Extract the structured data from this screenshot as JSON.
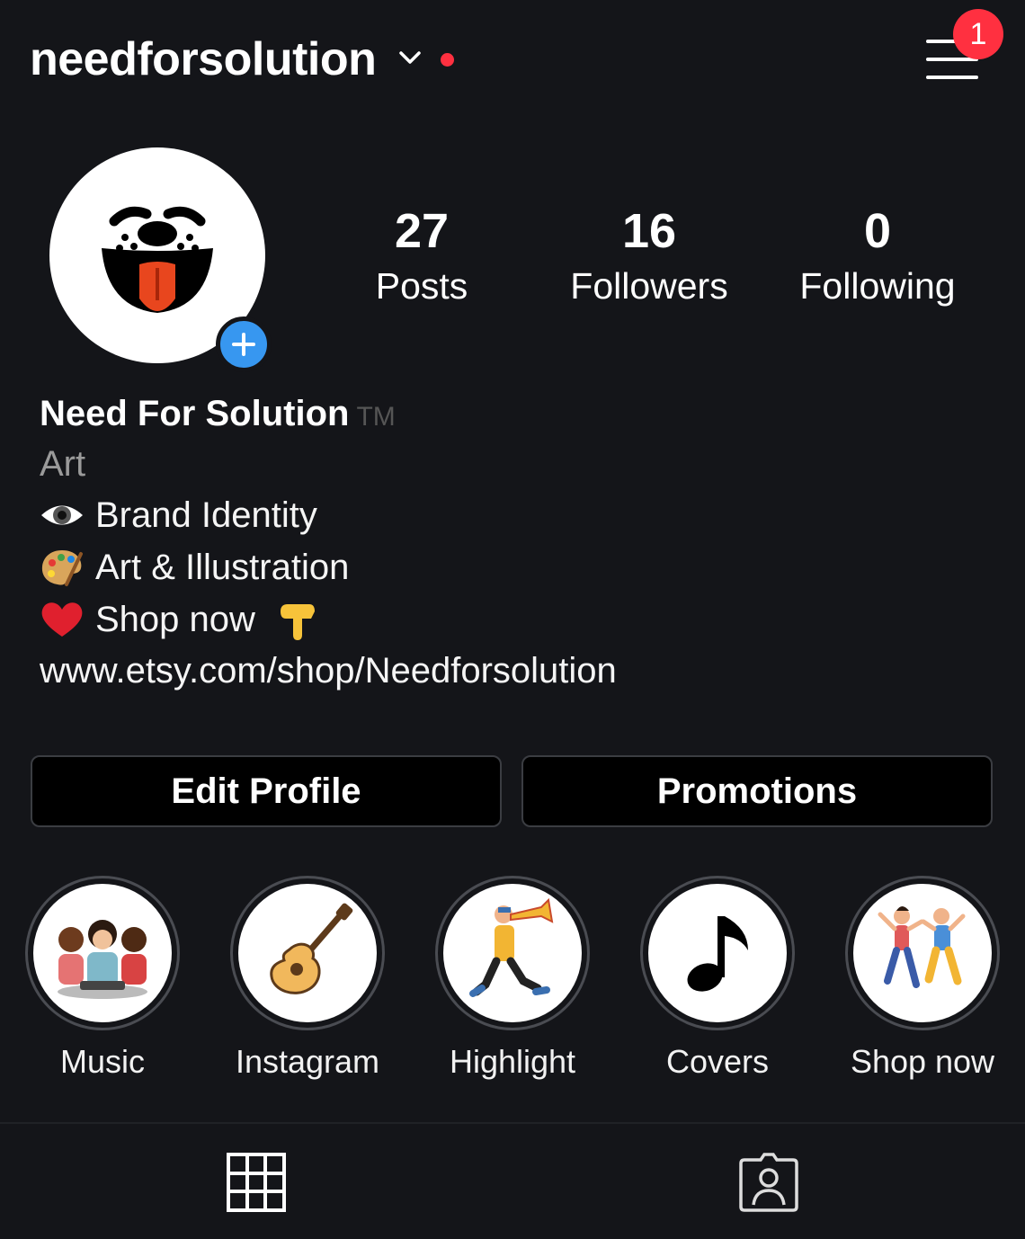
{
  "header": {
    "username": "needforsolution",
    "notification_count": "1"
  },
  "stats": [
    {
      "value": "27",
      "label": "Posts"
    },
    {
      "value": "16",
      "label": "Followers"
    },
    {
      "value": "0",
      "label": "Following"
    }
  ],
  "bio": {
    "name": "Need For Solution",
    "name_mark": "TM",
    "category": "Art",
    "lines": [
      {
        "icon": "eye-icon",
        "text": "Brand Identity"
      },
      {
        "icon": "palette-icon",
        "text": "Art & Illustration"
      },
      {
        "icon": "heart-icon",
        "text": "Shop now"
      }
    ],
    "link": "www.etsy.com/shop/Needforsolution"
  },
  "buttons": {
    "edit_profile": "Edit Profile",
    "promotions": "Promotions"
  },
  "highlights": [
    {
      "label": "Music"
    },
    {
      "label": "Instagram"
    },
    {
      "label": "Highlight"
    },
    {
      "label": "Covers"
    },
    {
      "label": "Shop now"
    }
  ],
  "colors": {
    "background": "#141519",
    "accent_blue": "#3797f0",
    "notification_red": "#ff3040"
  }
}
